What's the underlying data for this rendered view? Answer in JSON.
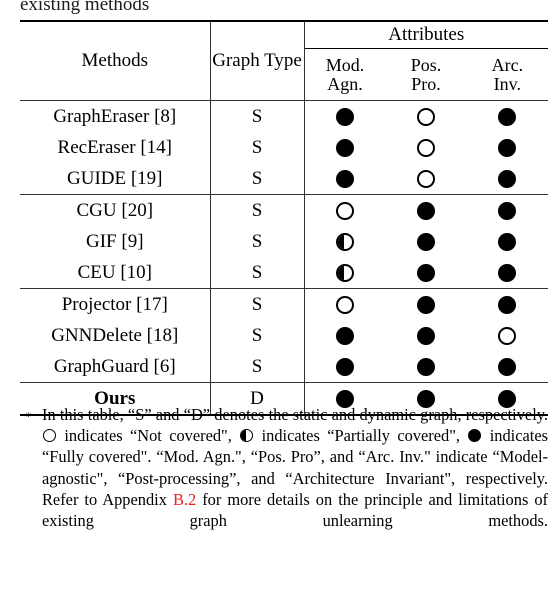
{
  "caption_tail": "existing methods",
  "table": {
    "headers": {
      "methods": "Methods",
      "graph_type_line1": "Graph",
      "graph_type_line2": "Type",
      "attributes_group": "Attributes",
      "attr_cols": [
        {
          "line1": "Mod.",
          "line2": "Agn."
        },
        {
          "line1": "Pos.",
          "line2": "Pro."
        },
        {
          "line1": "Arc.",
          "line2": "Inv."
        }
      ]
    },
    "groups": [
      {
        "rows": [
          {
            "method": "GraphEraser [8]",
            "graph_type": "S",
            "marks": [
              "full",
              "empty",
              "full"
            ],
            "bold": false
          },
          {
            "method": "RecEraser [14]",
            "graph_type": "S",
            "marks": [
              "full",
              "empty",
              "full"
            ],
            "bold": false
          },
          {
            "method": "GUIDE [19]",
            "graph_type": "S",
            "marks": [
              "full",
              "empty",
              "full"
            ],
            "bold": false
          }
        ]
      },
      {
        "rows": [
          {
            "method": "CGU [20]",
            "graph_type": "S",
            "marks": [
              "empty",
              "full",
              "full"
            ],
            "bold": false
          },
          {
            "method": "GIF [9]",
            "graph_type": "S",
            "marks": [
              "half",
              "full",
              "full"
            ],
            "bold": false
          },
          {
            "method": "CEU [10]",
            "graph_type": "S",
            "marks": [
              "half",
              "full",
              "full"
            ],
            "bold": false
          }
        ]
      },
      {
        "rows": [
          {
            "method": "Projector [17]",
            "graph_type": "S",
            "marks": [
              "empty",
              "full",
              "full"
            ],
            "bold": false
          },
          {
            "method": "GNNDelete [18]",
            "graph_type": "S",
            "marks": [
              "full",
              "full",
              "empty"
            ],
            "bold": false
          },
          {
            "method": "GraphGuard [6]",
            "graph_type": "S",
            "marks": [
              "full",
              "full",
              "full"
            ],
            "bold": false
          }
        ]
      },
      {
        "rows": [
          {
            "method": "Ours",
            "graph_type": "D",
            "marks": [
              "full",
              "full",
              "full"
            ],
            "bold": true
          }
        ]
      }
    ]
  },
  "footnote": {
    "marker": "*",
    "part1": "In this table, “S” and “D” denotes the static and dynamic graph, respectively. ",
    "part2": " indicates “Not covered\", ",
    "part3": " indicates “Partially covered\", ",
    "part4": " indicates “Fully covered\". “Mod. Agn.\", “Pos. Pro”, and “Arc. Inv.\" indicate “Model-agnostic\", “Post-processing”, and “Architecture Invariant\", respectively. Refer to Appendix ",
    "link": "B.2",
    "part5": " for more details on the principle and limitations of existing graph unlearning methods."
  },
  "colors": {
    "link": "#e8221d",
    "rule": "#000000",
    "text": "#000000"
  }
}
